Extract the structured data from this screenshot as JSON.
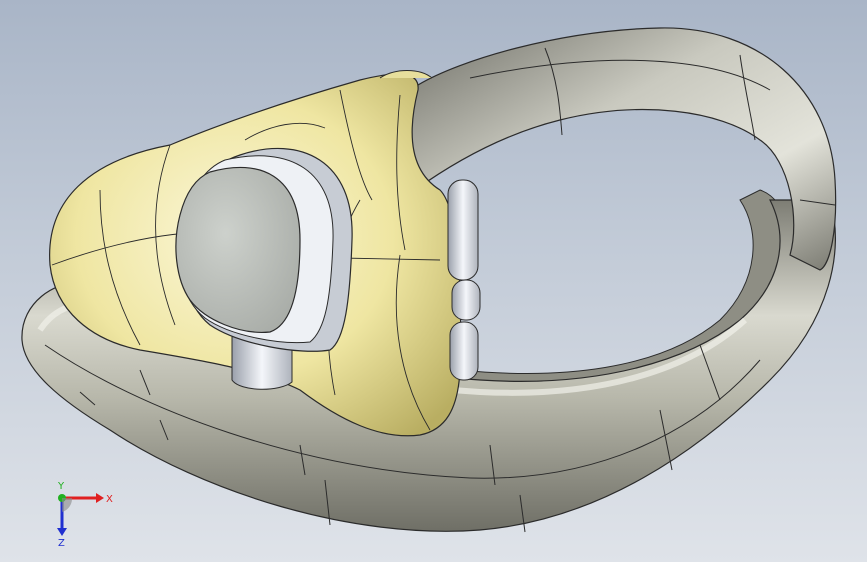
{
  "viewport": {
    "background_top": "#a9b5c7",
    "background_bottom": "#dfe3e9"
  },
  "model": {
    "body_color": "#efe7a6",
    "ring_color": "#b9b9ab",
    "button_color": "#e4e7ec",
    "lens_color": "#c3c7c2",
    "edge_color": "#2b2b2b"
  },
  "triad": {
    "x_label": "X",
    "y_label": "Y",
    "z_label": "Z",
    "x_color": "#e02020",
    "y_color": "#20b020",
    "z_color": "#2030d0"
  }
}
